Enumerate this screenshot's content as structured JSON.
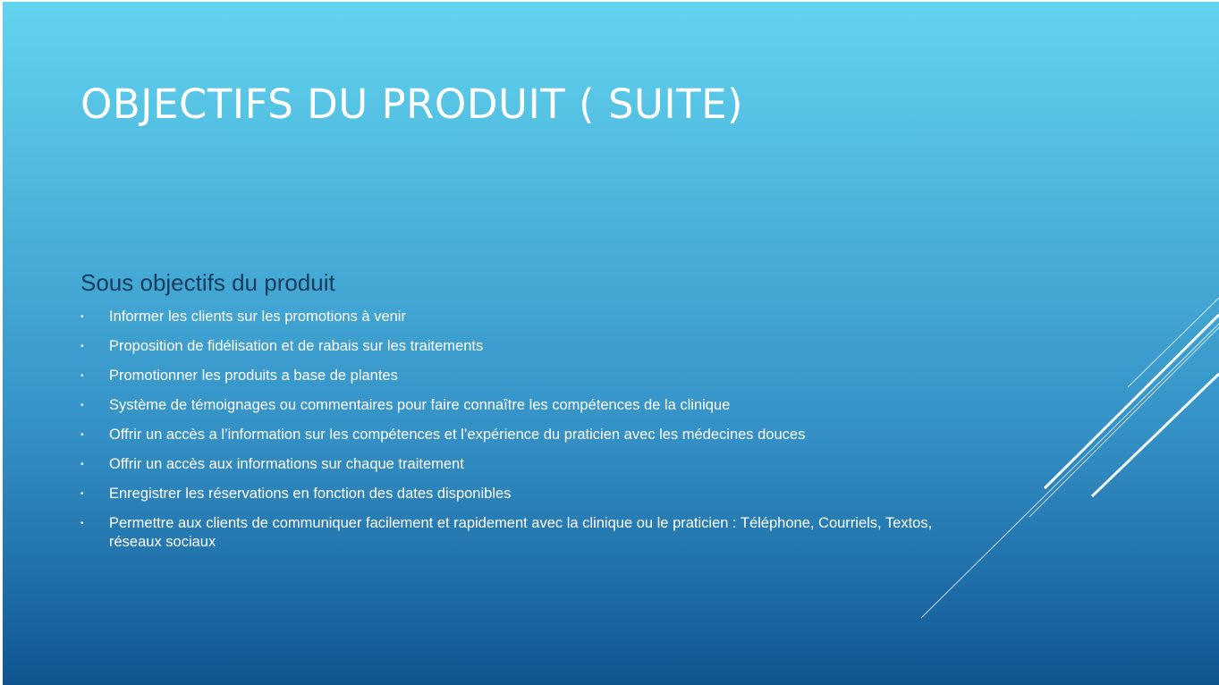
{
  "slide": {
    "title": "OBJECTIFS DU PRODUIT ( SUITE)",
    "subtitle": "Sous objectifs du produit",
    "bullet_marker": "•",
    "bullets": [
      "Informer les clients sur les promotions à venir",
      "Proposition de fidélisation et de rabais sur les traitements",
      "Promotionner les produits a base de plantes",
      "Système de témoignages ou commentaires pour faire connaître les compétences de la clinique",
      "Offrir un accès a l’information sur les compétences et l’expérience du praticien avec les médecines douces",
      "Offrir un accès aux informations sur chaque traitement",
      "Enregistrer les réservations en fonction des dates disponibles",
      "Permettre aux clients de communiquer facilement et rapidement avec la clinique ou le praticien : Téléphone, Courriels, Textos, réseaux sociaux"
    ]
  },
  "colors": {
    "background_top": "#62d4ef",
    "background_bottom": "#0f5590",
    "title_text": "#ffffff",
    "subtitle_text": "#173b5c",
    "body_text": "#ffffff",
    "decor_lines": "#ffffff"
  }
}
